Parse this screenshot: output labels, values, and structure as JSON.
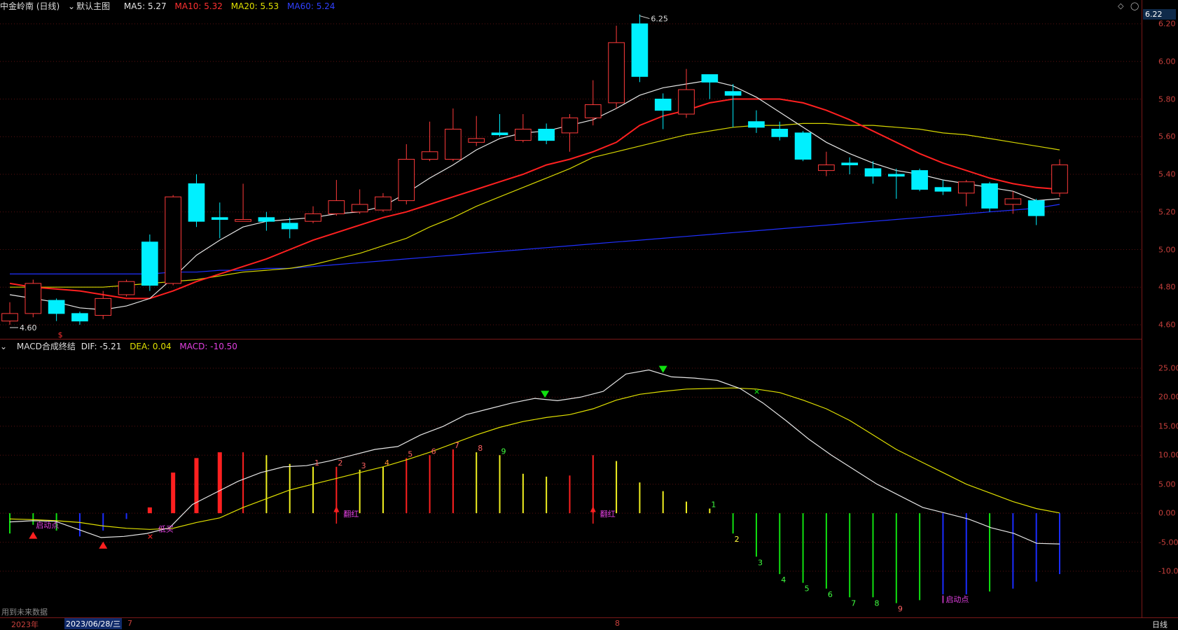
{
  "main_panel": {
    "stock_name": "中金岭南 (日线)",
    "template": "默认主图",
    "ma5": "MA5: 5.27",
    "ma10": "MA10: 5.32",
    "ma20": "MA20: 5.53",
    "ma60": "MA60: 5.24",
    "current_price_tag": "6.22",
    "high_label": "6.25",
    "low_label": "4.60",
    "price_ticks": [
      "6.20",
      "6.00",
      "5.80",
      "5.60",
      "5.40",
      "5.20",
      "5.00",
      "4.80",
      "4.60"
    ]
  },
  "macd_panel": {
    "title": "MACD合成终结",
    "dif": "DIF: -5.21",
    "dea": "DEA: 0.04",
    "macd": "MACD: -10.50",
    "ticks": [
      "25.00",
      "20.00",
      "15.00",
      "10.00",
      "5.00",
      "0.00",
      "-5.00",
      "-10.00"
    ],
    "labels": {
      "start1": "启动点",
      "low_buy": "低买",
      "turn_red1": "翻红",
      "turn_red2": "翻红",
      "start2": "启动点",
      "future_note": "用到未来数据"
    }
  },
  "bottom_bar": {
    "year": "2023年",
    "date": "2023/06/28/三",
    "m7": "7",
    "m8": "8",
    "period": "日线"
  },
  "colors": {
    "up": "#ff3b3b",
    "down": "#00f0ff",
    "ma5": "#e6e6e6",
    "ma10": "#ff2020",
    "ma20": "#d6d600",
    "ma60": "#2030ff",
    "dea": "#e0e000"
  },
  "chart_data": [
    {
      "type": "candlestick",
      "title": "中金岭南 (日线)",
      "ylim": [
        4.56,
        6.26
      ],
      "candles": [
        {
          "o": 4.62,
          "c": 4.66,
          "h": 4.72,
          "l": 4.6
        },
        {
          "o": 4.66,
          "c": 4.82,
          "h": 4.84,
          "l": 4.64
        },
        {
          "o": 4.73,
          "c": 4.66,
          "h": 4.74,
          "l": 4.62
        },
        {
          "o": 4.66,
          "c": 4.62,
          "h": 4.67,
          "l": 4.6
        },
        {
          "o": 4.65,
          "c": 4.74,
          "h": 4.78,
          "l": 4.63
        },
        {
          "o": 4.76,
          "c": 4.83,
          "h": 4.84,
          "l": 4.75
        },
        {
          "o": 5.04,
          "c": 4.81,
          "h": 5.08,
          "l": 4.78
        },
        {
          "o": 4.82,
          "c": 5.28,
          "h": 5.29,
          "l": 4.81
        },
        {
          "o": 5.35,
          "c": 5.15,
          "h": 5.4,
          "l": 5.12
        },
        {
          "o": 5.17,
          "c": 5.16,
          "h": 5.25,
          "l": 5.06
        },
        {
          "o": 5.15,
          "c": 5.16,
          "h": 5.35,
          "l": 5.15
        },
        {
          "o": 5.17,
          "c": 5.15,
          "h": 5.2,
          "l": 5.1
        },
        {
          "o": 5.14,
          "c": 5.11,
          "h": 5.17,
          "l": 5.06
        },
        {
          "o": 5.15,
          "c": 5.19,
          "h": 5.23,
          "l": 5.14
        },
        {
          "o": 5.19,
          "c": 5.26,
          "h": 5.37,
          "l": 5.18
        },
        {
          "o": 5.2,
          "c": 5.24,
          "h": 5.32,
          "l": 5.19
        },
        {
          "o": 5.21,
          "c": 5.28,
          "h": 5.3,
          "l": 5.2
        },
        {
          "o": 5.26,
          "c": 5.48,
          "h": 5.56,
          "l": 5.24
        },
        {
          "o": 5.48,
          "c": 5.52,
          "h": 5.68,
          "l": 5.47
        },
        {
          "o": 5.48,
          "c": 5.64,
          "h": 5.75,
          "l": 5.47
        },
        {
          "o": 5.57,
          "c": 5.59,
          "h": 5.71,
          "l": 5.55
        },
        {
          "o": 5.62,
          "c": 5.61,
          "h": 5.72,
          "l": 5.6
        },
        {
          "o": 5.58,
          "c": 5.64,
          "h": 5.72,
          "l": 5.57
        },
        {
          "o": 5.64,
          "c": 5.58,
          "h": 5.67,
          "l": 5.56
        },
        {
          "o": 5.62,
          "c": 5.7,
          "h": 5.72,
          "l": 5.52
        },
        {
          "o": 5.7,
          "c": 5.77,
          "h": 5.9,
          "l": 5.66
        },
        {
          "o": 5.78,
          "c": 6.1,
          "h": 6.19,
          "l": 5.75
        },
        {
          "o": 6.2,
          "c": 5.92,
          "h": 6.25,
          "l": 5.89
        },
        {
          "o": 5.8,
          "c": 5.74,
          "h": 5.83,
          "l": 5.64
        },
        {
          "o": 5.72,
          "c": 5.85,
          "h": 5.96,
          "l": 5.7
        },
        {
          "o": 5.93,
          "c": 5.89,
          "h": 5.93,
          "l": 5.8
        },
        {
          "o": 5.84,
          "c": 5.82,
          "h": 5.88,
          "l": 5.65
        },
        {
          "o": 5.68,
          "c": 5.65,
          "h": 5.74,
          "l": 5.62
        },
        {
          "o": 5.64,
          "c": 5.6,
          "h": 5.68,
          "l": 5.58
        },
        {
          "o": 5.62,
          "c": 5.48,
          "h": 5.63,
          "l": 5.47
        },
        {
          "o": 5.42,
          "c": 5.45,
          "h": 5.52,
          "l": 5.39
        },
        {
          "o": 5.46,
          "c": 5.45,
          "h": 5.49,
          "l": 5.4
        },
        {
          "o": 5.43,
          "c": 5.39,
          "h": 5.47,
          "l": 5.35
        },
        {
          "o": 5.4,
          "c": 5.39,
          "h": 5.43,
          "l": 5.27
        },
        {
          "o": 5.42,
          "c": 5.32,
          "h": 5.43,
          "l": 5.31
        },
        {
          "o": 5.33,
          "c": 5.31,
          "h": 5.37,
          "l": 5.29
        },
        {
          "o": 5.3,
          "c": 5.36,
          "h": 5.37,
          "l": 5.23
        },
        {
          "o": 5.35,
          "c": 5.22,
          "h": 5.36,
          "l": 5.2
        },
        {
          "o": 5.24,
          "c": 5.27,
          "h": 5.31,
          "l": 5.19
        },
        {
          "o": 5.26,
          "c": 5.18,
          "h": 5.27,
          "l": 5.13
        },
        {
          "o": 5.3,
          "c": 5.45,
          "h": 5.48,
          "l": 5.28
        }
      ],
      "ma5": [
        4.76,
        4.74,
        4.72,
        4.69,
        4.68,
        4.7,
        4.74,
        4.85,
        4.97,
        5.05,
        5.12,
        5.15,
        5.16,
        5.17,
        5.19,
        5.2,
        5.23,
        5.3,
        5.38,
        5.45,
        5.53,
        5.59,
        5.62,
        5.63,
        5.66,
        5.69,
        5.75,
        5.82,
        5.86,
        5.88,
        5.9,
        5.87,
        5.81,
        5.73,
        5.65,
        5.57,
        5.51,
        5.46,
        5.42,
        5.4,
        5.37,
        5.35,
        5.33,
        5.31,
        5.26,
        5.27
      ],
      "ma10": [
        4.82,
        4.8,
        4.79,
        4.78,
        4.76,
        4.74,
        4.74,
        4.78,
        4.83,
        4.87,
        4.91,
        4.95,
        5.0,
        5.05,
        5.09,
        5.13,
        5.17,
        5.2,
        5.24,
        5.28,
        5.32,
        5.36,
        5.4,
        5.45,
        5.48,
        5.52,
        5.57,
        5.66,
        5.71,
        5.74,
        5.78,
        5.8,
        5.8,
        5.8,
        5.78,
        5.74,
        5.69,
        5.63,
        5.57,
        5.51,
        5.46,
        5.42,
        5.38,
        5.35,
        5.33,
        5.32
      ],
      "ma20": [
        4.8,
        4.8,
        4.8,
        4.8,
        4.8,
        4.81,
        4.82,
        4.83,
        4.84,
        4.86,
        4.88,
        4.89,
        4.9,
        4.92,
        4.95,
        4.98,
        5.02,
        5.06,
        5.12,
        5.17,
        5.23,
        5.28,
        5.33,
        5.38,
        5.43,
        5.49,
        5.52,
        5.55,
        5.58,
        5.61,
        5.63,
        5.65,
        5.66,
        5.66,
        5.67,
        5.67,
        5.66,
        5.66,
        5.65,
        5.64,
        5.62,
        5.61,
        5.59,
        5.57,
        5.55,
        5.53
      ],
      "ma60": [
        4.87,
        4.87,
        4.87,
        4.87,
        4.87,
        4.87,
        4.87,
        4.88,
        4.88,
        4.89,
        4.89,
        4.9,
        4.9,
        4.91,
        4.92,
        4.93,
        4.94,
        4.95,
        4.96,
        4.97,
        4.98,
        4.99,
        5.0,
        5.01,
        5.02,
        5.03,
        5.04,
        5.05,
        5.06,
        5.07,
        5.08,
        5.09,
        5.1,
        5.11,
        5.12,
        5.13,
        5.14,
        5.15,
        5.16,
        5.17,
        5.18,
        5.19,
        5.2,
        5.21,
        5.22,
        5.24
      ]
    },
    {
      "type": "line",
      "title": "MACD合成终结",
      "ylim": [
        -15.5,
        29
      ],
      "dif": [
        -1.5,
        -1.3,
        -1.4,
        -2.8,
        -4.2,
        -4.0,
        -3.5,
        -2.5,
        1.5,
        3.5,
        5.5,
        7.0,
        8.0,
        8.2,
        9.0,
        10.0,
        11.0,
        11.5,
        13.5,
        15.0,
        17.0,
        18.0,
        19.0,
        19.8,
        19.4,
        20.0,
        21.0,
        24.0,
        24.7,
        23.5,
        23.3,
        22.9,
        21.5,
        19.0,
        16.0,
        12.8,
        10.0,
        7.5,
        5.0,
        3.0,
        1.0,
        0.0,
        -1.0,
        -2.5,
        -3.5,
        -5.2,
        -5.3
      ],
      "dea": [
        -1.0,
        -1.1,
        -1.3,
        -1.6,
        -2.2,
        -2.6,
        -2.8,
        -2.6,
        -1.6,
        -0.8,
        1.0,
        2.5,
        4.0,
        5.0,
        6.0,
        7.0,
        8.0,
        9.2,
        10.5,
        12.0,
        13.5,
        14.8,
        15.8,
        16.5,
        17.0,
        18.0,
        19.5,
        20.5,
        21.0,
        21.4,
        21.5,
        21.6,
        21.4,
        20.8,
        19.5,
        18.0,
        16.0,
        13.5,
        11.0,
        9.0,
        7.0,
        5.0,
        3.5,
        2.0,
        0.8,
        0.04
      ],
      "macd": [
        -3.5,
        -2.0,
        -3.0,
        -4.0,
        -3.0,
        -1.0,
        1.0,
        7.0,
        9.5,
        10.5,
        10.5,
        10.0,
        8.5,
        8.0,
        8.0,
        7.5,
        8.0,
        9.5,
        10.0,
        11.0,
        10.5,
        10.0,
        6.8,
        6.3,
        6.5,
        10.0,
        9.0,
        5.3,
        3.8,
        2.0,
        0.8,
        -3.5,
        -7.5,
        -10.5,
        -12.0,
        -13.0,
        -14.5,
        -14.5,
        -15.5,
        -15.0,
        -14.0,
        -14.0,
        -13.5,
        -13.0,
        -11.8,
        -10.5
      ],
      "macd_colors": [
        "green",
        "green",
        "green",
        "blue",
        "blue",
        "blue",
        "red",
        "red",
        "red",
        "red",
        "red",
        "yellow",
        "yellow",
        "yellow",
        "red",
        "yellow",
        "yellow",
        "red",
        "red",
        "red",
        "yellow",
        "yellow",
        "yellow",
        "yellow",
        "red",
        "red",
        "yellow",
        "yellow",
        "yellow",
        "yellow",
        "yellow",
        "green",
        "green",
        "green",
        "green",
        "green",
        "green",
        "green",
        "green",
        "green",
        "blue",
        "blue",
        "green",
        "blue",
        "blue",
        "blue"
      ]
    }
  ]
}
